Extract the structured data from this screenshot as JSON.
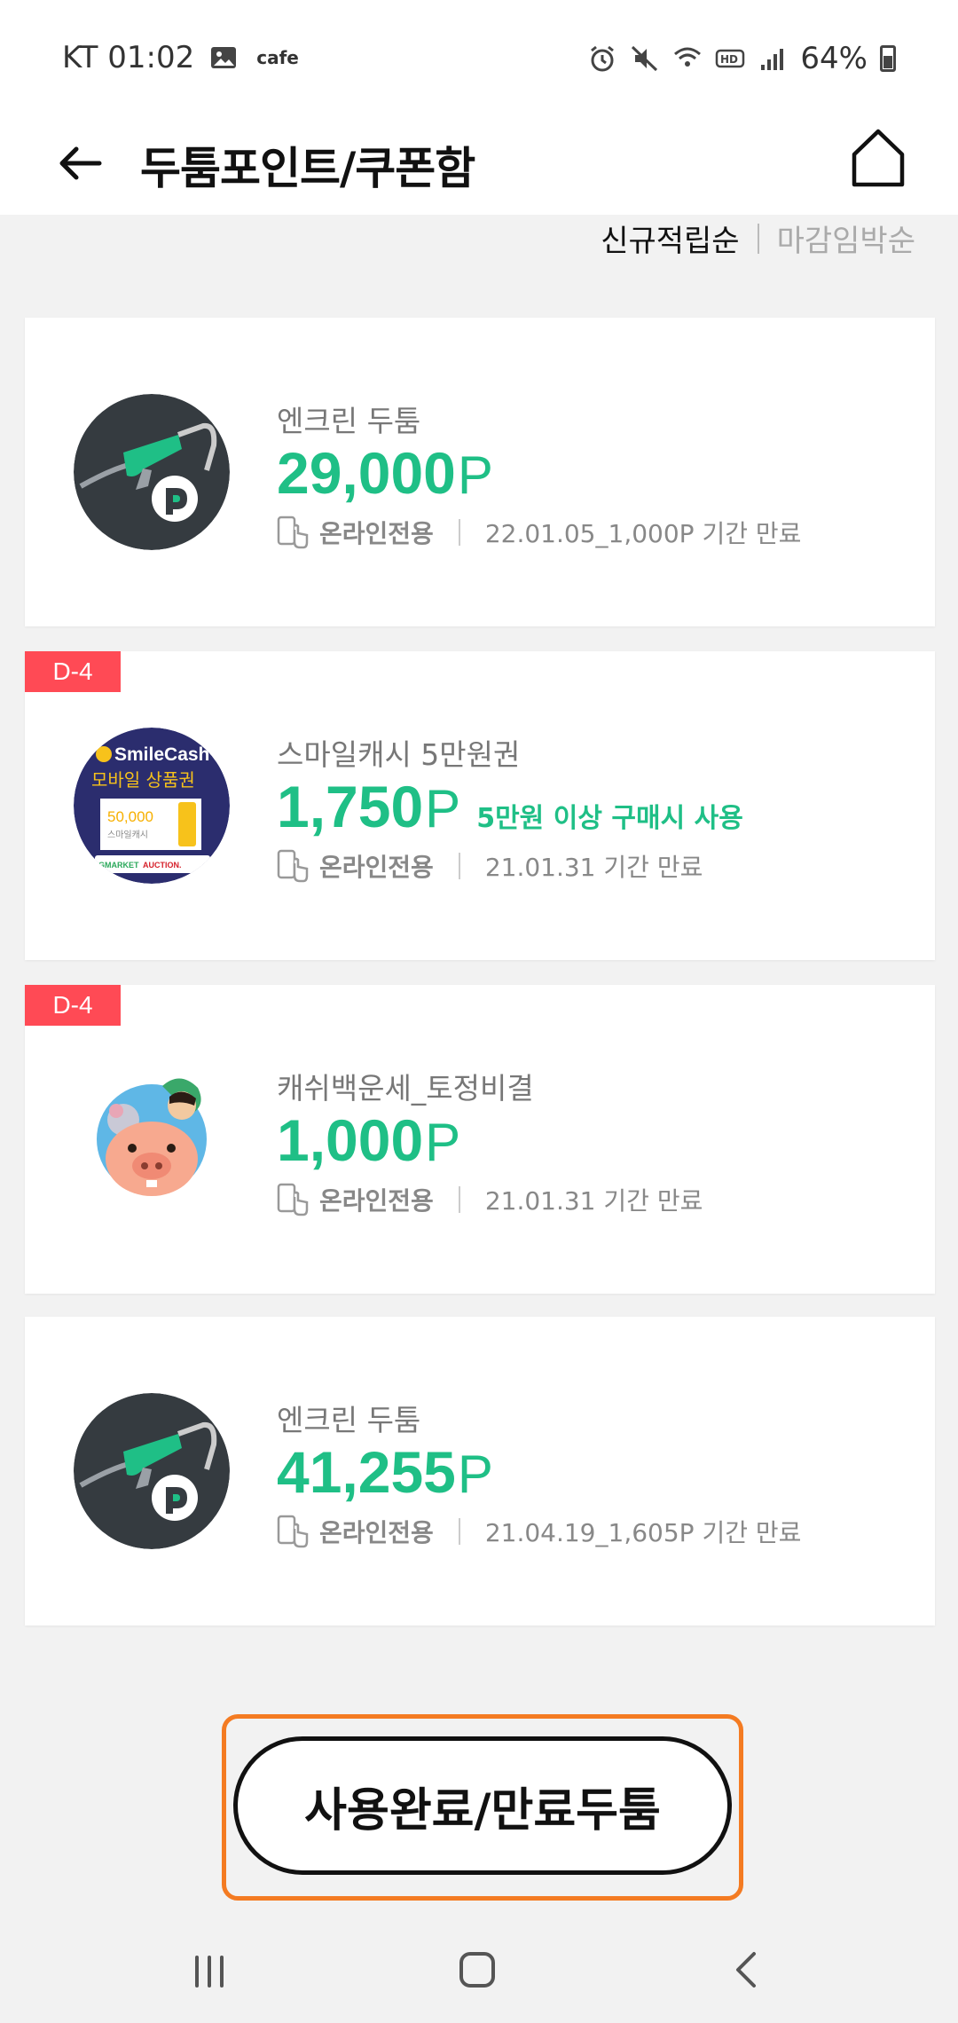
{
  "status_bar": {
    "carrier_time": "KT 01:02",
    "cafe_label": "cafe",
    "battery": "64%"
  },
  "header": {
    "title": "두툼포인트/쿠폰함"
  },
  "sort": {
    "active": "신규적립순",
    "inactive": "마감임박순"
  },
  "cards": [
    {
      "badge": "",
      "name": "엔크린 두툼",
      "points": "29,000",
      "unit": "P",
      "condition": "",
      "online": "온라인전용",
      "expiry": "22.01.05_1,000P 기간 만료",
      "thumb": "enclean-fuel"
    },
    {
      "badge": "D-4",
      "name": "스마일캐시 5만원권",
      "points": "1,750",
      "unit": "P",
      "condition": "5만원 이상 구매시 사용",
      "online": "온라인전용",
      "expiry": "21.01.31 기간 만료",
      "thumb": "smilecash",
      "thumb_text": {
        "brand": "SmileCash",
        "subtitle": "모바일 상품권",
        "amount": "50,000",
        "small": "스마일캐시",
        "gmarket": "GMARKET",
        "auction": "AUCTION."
      }
    },
    {
      "badge": "D-4",
      "name": "캐쉬백운세_토정비결",
      "points": "1,000",
      "unit": "P",
      "condition": "",
      "online": "온라인전용",
      "expiry": "21.01.31 기간 만료",
      "thumb": "fortune-pig"
    },
    {
      "badge": "",
      "name": "엔크린 두툼",
      "points": "41,255",
      "unit": "P",
      "condition": "",
      "online": "온라인전용",
      "expiry": "21.04.19_1,605P 기간 만료",
      "thumb": "enclean-fuel"
    }
  ],
  "footer_button": "사용완료/만료두툼",
  "colors": {
    "accent_green": "#1fbf86",
    "badge_red": "#ff4a55",
    "highlight_orange": "#f47b22"
  }
}
